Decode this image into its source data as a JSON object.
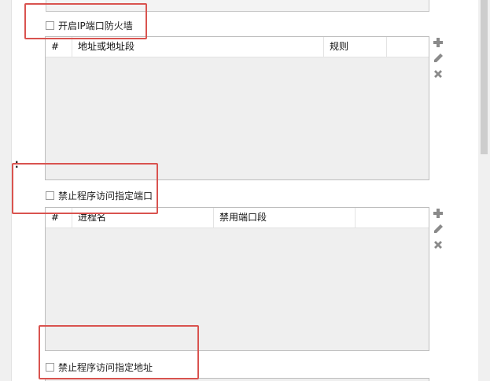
{
  "firewall": {
    "enable_label": "开启IP端口防火墙",
    "address_table": {
      "columns": [
        "#",
        "地址或地址段",
        "规则"
      ]
    }
  },
  "block_ports": {
    "label": "禁止程序访问指定端口",
    "table": {
      "columns": [
        "#",
        "进程名",
        "禁用端口段"
      ]
    }
  },
  "block_addresses": {
    "label": "禁止程序访问指定地址"
  },
  "icons": {
    "add": "plus-icon",
    "edit": "pencil-icon",
    "delete": "close-icon"
  },
  "colors": {
    "highlight": "#d9534f",
    "icon": "#8a8a8a"
  }
}
